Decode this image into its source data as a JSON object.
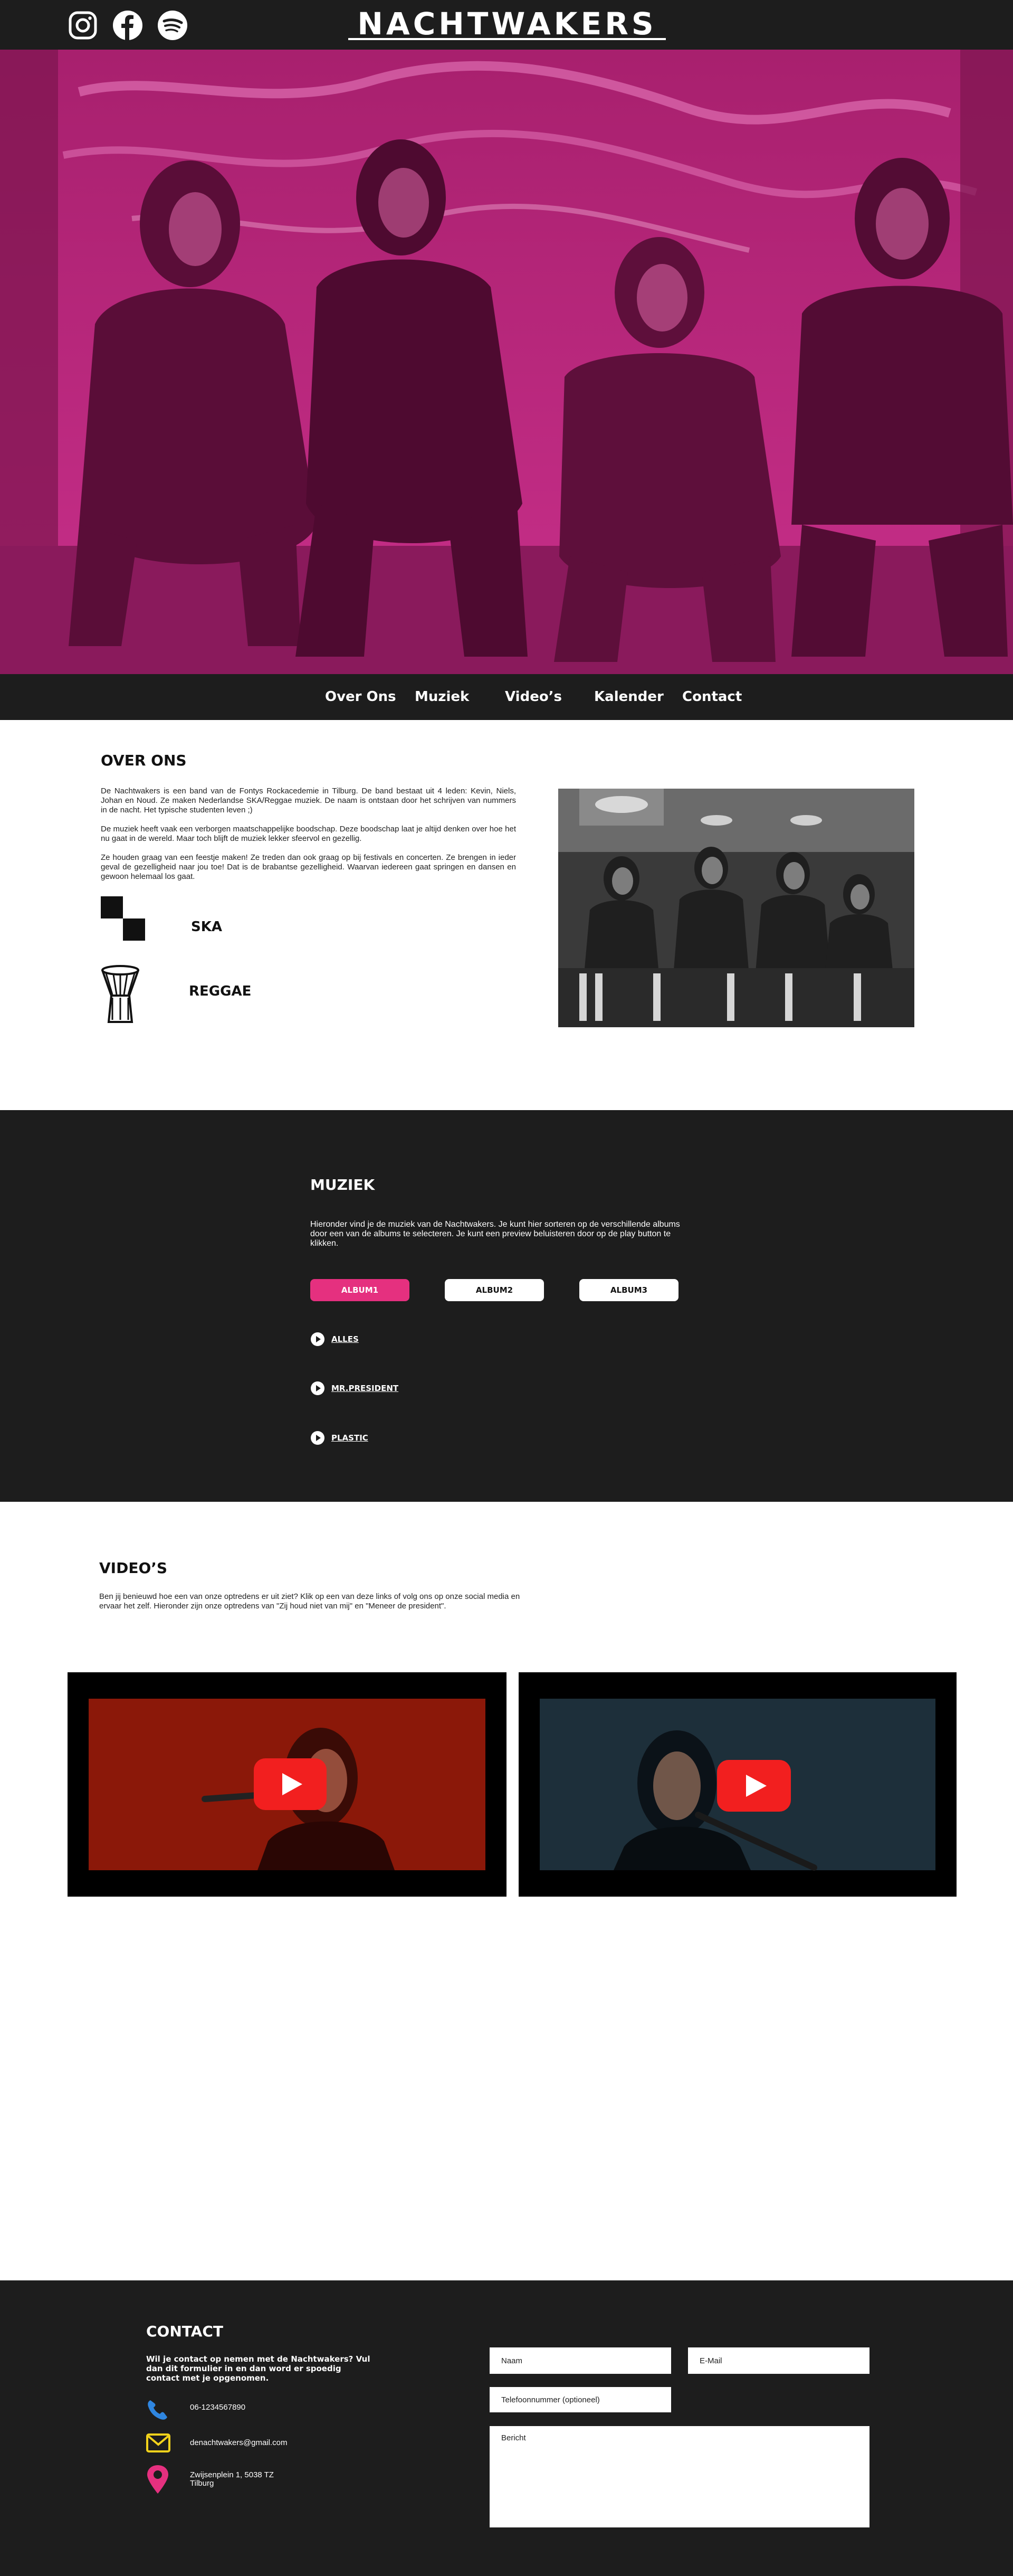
{
  "header": {
    "logo": "NACHTWAKERS",
    "social": [
      {
        "icon": "instagram-icon"
      },
      {
        "icon": "facebook-icon"
      },
      {
        "icon": "spotify-icon"
      }
    ]
  },
  "nav": {
    "items": [
      "Over Ons",
      "Muziek",
      "Video’s",
      "Kalender",
      "Contact"
    ]
  },
  "about": {
    "title": "OVER ONS",
    "paragraphs": [
      "De Nachtwakers is een band van de Fontys Rockacedemie in Tilburg. De band bestaat uit 4 leden: Kevin, Niels, Johan en Noud. Ze maken Nederlandse SKA/Reggae muziek. De naam is ontstaan door het schrijven van nummers in de nacht. Het typische studenten leven ;)",
      "De muziek heeft vaak een verborgen maatschappelijke boodschap. Deze boodschap laat je altijd denken over hoe het nu gaat in de wereld. Maar toch blijft de muziek lekker sfeervol en gezellig.",
      "Ze houden graag van een feestje maken! Ze treden dan ook graag op bij festivals en concerten. Ze brengen in ieder geval de gezelligheid naar jou toe! Dat is de brabantse gezelligheid. Waarvan iedereen gaat springen en dansen en gewoon helemaal los gaat."
    ],
    "genres": [
      {
        "label": "SKA",
        "icon": "checkered-flag-icon"
      },
      {
        "label": "REGGAE",
        "icon": "djembe-drum-icon"
      }
    ]
  },
  "music": {
    "title": "MUZIEK",
    "text": "Hieronder vind je de muziek van de Nachtwakers. Je kunt hier sorteren op de verschillende albums door een van de albums te selecteren. Je kunt een preview beluisteren door op de play button te klikken.",
    "albums": [
      {
        "label": "ALBUM1",
        "active": true
      },
      {
        "label": "ALBUM2",
        "active": false
      },
      {
        "label": "ALBUM3",
        "active": false
      }
    ],
    "tracks": [
      "ALLES",
      "MR.PRESIDENT",
      "PLASTIC"
    ],
    "accent": "#e5307f"
  },
  "videos": {
    "title": "VIDEO’S",
    "text": "Ben jij benieuwd hoe een van onze optredens er uit ziet? Klik op een van deze links of volg ons op onze social media en ervaar het zelf. Hieronder zijn onze optredens van \"Zij houd niet van mij\" en \"Meneer de president\".",
    "items": [
      {
        "icon": "youtube-play-icon",
        "tint": "#8a1a0c"
      },
      {
        "icon": "youtube-play-icon",
        "tint": "#1c2a36"
      }
    ]
  },
  "contact": {
    "title": "CONTACT",
    "text": "Wil je contact op nemen met de Nachtwakers? Vul dan dit formulier in en dan word er spoedig contact met je opgenomen.",
    "phone": "06-1234567890",
    "email": "denachtwakers@gmail.com",
    "address_line1": "Zwijsenplein 1, 5038 TZ",
    "address_line2": "Tilburg",
    "form": {
      "name_placeholder": "Naam",
      "email_placeholder": "E-Mail",
      "phone_placeholder": "Telefoonnummer (optioneel)",
      "message_placeholder": "Bericht"
    },
    "icon_colors": {
      "phone": "#2f86e0",
      "email": "#f2d21b",
      "location": "#e5307f"
    }
  }
}
